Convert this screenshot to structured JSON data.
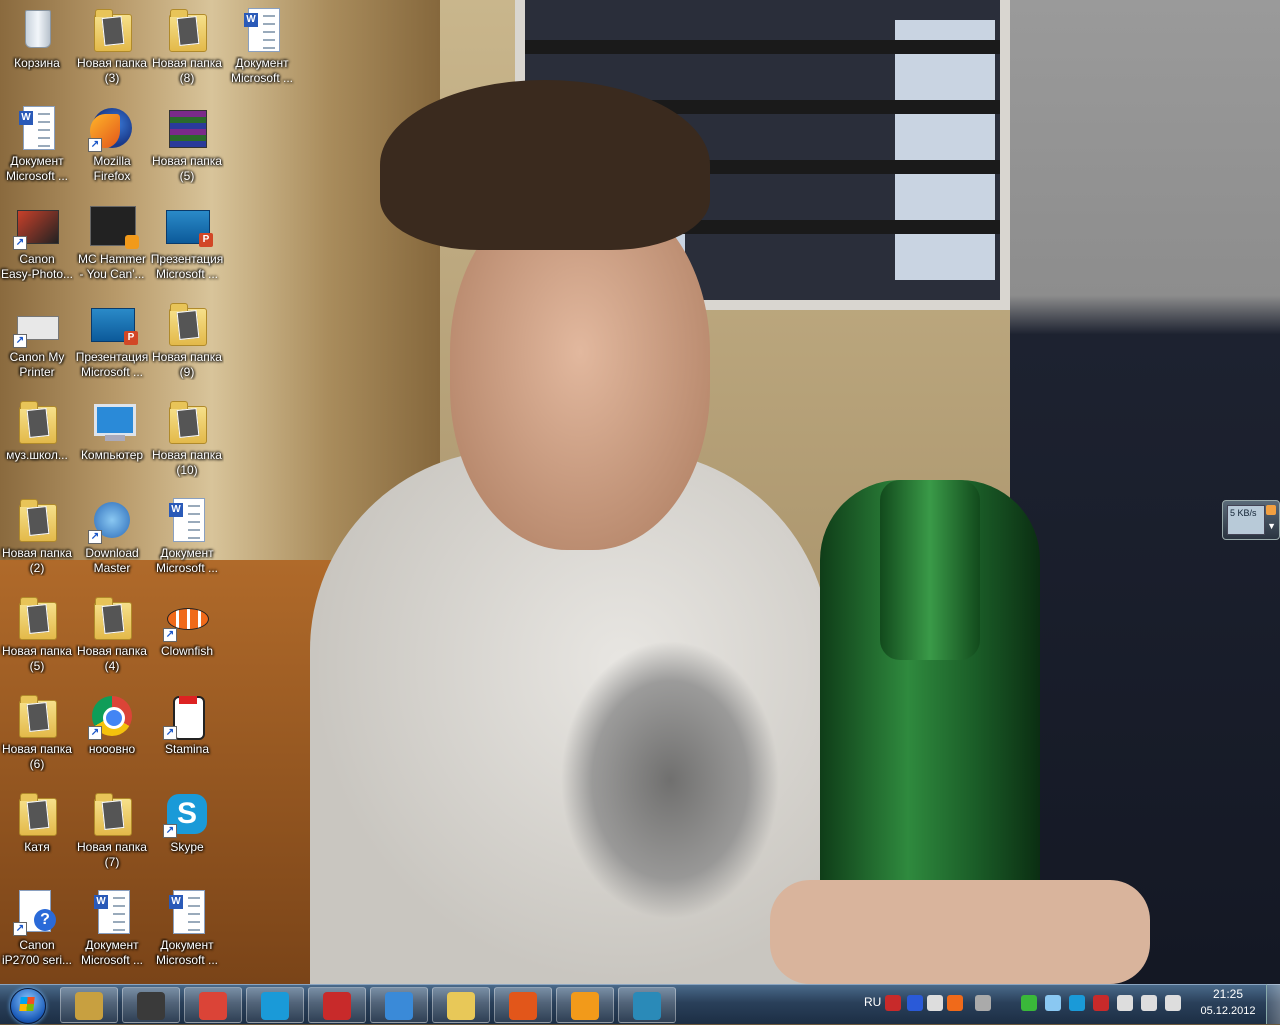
{
  "desktop": {
    "icons": [
      {
        "label": "Корзина",
        "art": "recycle-bin"
      },
      {
        "label": "Новая папка\n(3)",
        "art": "folder"
      },
      {
        "label": "Новая папка\n(8)",
        "art": "folder"
      },
      {
        "label": "Документ\nMicrosoft ...",
        "art": "word-document"
      },
      {
        "label": "Документ\nMicrosoft ...",
        "art": "word-document"
      },
      {
        "label": "Mozilla\nFirefox",
        "art": "firefox"
      },
      {
        "label": "Новая папка\n(5)",
        "art": "winrar"
      },
      {
        "label": "Canon\nEasy-Photo...",
        "art": "camera"
      },
      {
        "label": "MC Hammer\n- You Can'...",
        "art": "video"
      },
      {
        "label": "Презентация\nMicrosoft ...",
        "art": "powerpoint"
      },
      {
        "label": "Canon My\nPrinter",
        "art": "printer"
      },
      {
        "label": "Презентация\nMicrosoft ...",
        "art": "powerpoint"
      },
      {
        "label": "Новая папка\n(9)",
        "art": "folder"
      },
      {
        "label": "муз.школ...",
        "art": "folder"
      },
      {
        "label": "Компьютер",
        "art": "computer"
      },
      {
        "label": "Новая папка\n(10)",
        "art": "folder"
      },
      {
        "label": "Новая папка\n(2)",
        "art": "folder"
      },
      {
        "label": "Download\nMaster",
        "art": "download-master"
      },
      {
        "label": "Документ\nMicrosoft ...",
        "art": "word-document"
      },
      {
        "label": "Новая папка\n(5)",
        "art": "folder"
      },
      {
        "label": "Новая папка\n(4)",
        "art": "folder"
      },
      {
        "label": "Clownfish",
        "art": "clownfish"
      },
      {
        "label": "Новая папка\n(6)",
        "art": "folder"
      },
      {
        "label": "нооовно",
        "art": "chrome"
      },
      {
        "label": "Stamina",
        "art": "stamina"
      },
      {
        "label": "Катя",
        "art": "folder"
      },
      {
        "label": "Новая папка\n(7)",
        "art": "folder"
      },
      {
        "label": "Skype",
        "art": "skype"
      },
      {
        "label": "Canon\niP2700 seri...",
        "art": "help-document"
      },
      {
        "label": "Документ\nMicrosoft ...",
        "art": "word-document"
      },
      {
        "label": "Документ\nMicrosoft ...",
        "art": "word-document"
      }
    ]
  },
  "gadget": {
    "speed_text": "5 KB/s"
  },
  "taskbar": {
    "pinned": [
      {
        "name": "windows-explorer",
        "color": "#c8a040"
      },
      {
        "name": "display-settings",
        "color": "#3a3a3a"
      },
      {
        "name": "chrome",
        "color": "#db4437"
      },
      {
        "name": "skype",
        "color": "#1a9ad8"
      },
      {
        "name": "kaspersky",
        "color": "#c82a2a"
      },
      {
        "name": "control-panel",
        "color": "#3a8ad8"
      },
      {
        "name": "paint",
        "color": "#e8c858"
      },
      {
        "name": "firefox",
        "color": "#e2561a"
      },
      {
        "name": "media-player",
        "color": "#f29a1a"
      },
      {
        "name": "camera-app",
        "color": "#2a8ab8"
      }
    ],
    "tray": {
      "language": "RU",
      "icons": [
        {
          "name": "acrobat-icon",
          "color": "#c82a2a"
        },
        {
          "name": "help-icon",
          "color": "#2a5ad8"
        },
        {
          "name": "usb-icon",
          "color": "#dddddd"
        },
        {
          "name": "clownfish-icon",
          "color": "#f06a1a"
        },
        {
          "name": "printer-icon",
          "color": "#aaaaaa"
        },
        {
          "name": "shield-icon",
          "color": "#3ab83a"
        },
        {
          "name": "network-share-icon",
          "color": "#8ac8f2"
        },
        {
          "name": "skype-icon",
          "color": "#1a9ad8"
        },
        {
          "name": "kaspersky-icon",
          "color": "#c82a2a"
        },
        {
          "name": "volume-icon",
          "color": "#dddddd"
        },
        {
          "name": "network-error-icon",
          "color": "#dddddd"
        },
        {
          "name": "action-center-icon",
          "color": "#dddddd"
        }
      ]
    },
    "clock": {
      "time": "21:25",
      "date": "05.12.2012"
    }
  }
}
